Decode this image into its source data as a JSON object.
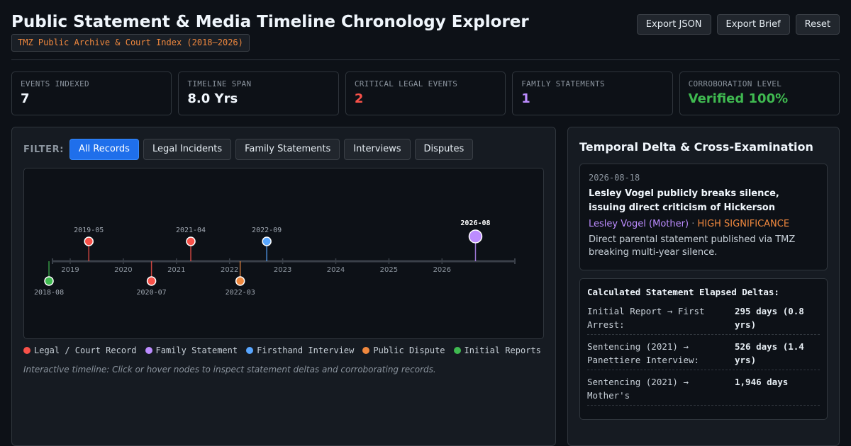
{
  "header": {
    "title": "Public Statement & Media Timeline Chronology Explorer",
    "source_tag": "TMZ Public Archive & Court Index (2018–2026)",
    "actions": [
      "Export JSON",
      "Export Brief",
      "Reset"
    ]
  },
  "stats": [
    {
      "label": "EVENTS INDEXED",
      "value": "7",
      "color": "#f0f6fc"
    },
    {
      "label": "TIMELINE SPAN",
      "value": "8.0 Yrs",
      "color": "#f0f6fc"
    },
    {
      "label": "CRITICAL LEGAL EVENTS",
      "value": "2",
      "color": "#f85149"
    },
    {
      "label": "FAMILY STATEMENTS",
      "value": "1",
      "color": "#bc8cff"
    },
    {
      "label": "CORROBORATION LEVEL",
      "value": "Verified 100%",
      "color": "#3fb950"
    }
  ],
  "filter": {
    "label": "FILTER:",
    "options": [
      "All Records",
      "Legal Incidents",
      "Family Statements",
      "Interviews",
      "Disputes"
    ],
    "active_index": 0
  },
  "timeline": {
    "years": [
      "2019",
      "2020",
      "2021",
      "2022",
      "2023",
      "2024",
      "2025",
      "2026"
    ],
    "events": [
      {
        "label": "2018-08",
        "date": 2018.6,
        "category": "initial",
        "side": "below",
        "selected": false
      },
      {
        "label": "2019-05",
        "date": 2019.35,
        "category": "legal",
        "side": "above",
        "selected": false
      },
      {
        "label": "2020-07",
        "date": 2020.53,
        "category": "legal",
        "side": "below",
        "selected": false
      },
      {
        "label": "2021-04",
        "date": 2021.27,
        "category": "legal",
        "side": "above",
        "selected": false
      },
      {
        "label": "2022-03",
        "date": 2022.2,
        "category": "dispute",
        "side": "below",
        "selected": false
      },
      {
        "label": "2022-09",
        "date": 2022.7,
        "category": "interview",
        "side": "above",
        "selected": false
      },
      {
        "label": "2026-08",
        "date": 2026.63,
        "category": "family",
        "side": "above",
        "selected": true
      }
    ],
    "category_colors": {
      "legal": "#f85149",
      "family": "#bc8cff",
      "interview": "#58a6ff",
      "dispute": "#f0883e",
      "initial": "#3fb950"
    }
  },
  "legend": [
    {
      "label": "Legal / Court Record",
      "color": "#f85149"
    },
    {
      "label": "Family Statement",
      "color": "#bc8cff"
    },
    {
      "label": "Firsthand Interview",
      "color": "#58a6ff"
    },
    {
      "label": "Public Dispute",
      "color": "#f0883e"
    },
    {
      "label": "Initial Reports",
      "color": "#3fb950"
    }
  ],
  "hint": "Interactive timeline: Click or hover nodes to inspect statement deltas and corroborating records.",
  "right_panel": {
    "title": "Temporal Delta & Cross-Examination",
    "event": {
      "date": "2026-08-18",
      "title": "Lesley Vogel publicly breaks silence, issuing direct criticism of Hickerson",
      "source": "Lesley Vogel (Mother)",
      "separator": "·",
      "significance": "HIGH SIGNIFICANCE",
      "description": "Direct parental statement published via TMZ breaking multi-year silence."
    },
    "deltas": {
      "heading": "Calculated Statement Elapsed Deltas:",
      "rows": [
        {
          "label": "Initial Report → First Arrest:",
          "value": "295 days (0.8 yrs)"
        },
        {
          "label": "Sentencing (2021) → Panettiere Interview:",
          "value": "526 days (1.4 yrs)"
        },
        {
          "label": "Sentencing (2021) → Mother's",
          "value": "1,946 days"
        }
      ]
    }
  }
}
